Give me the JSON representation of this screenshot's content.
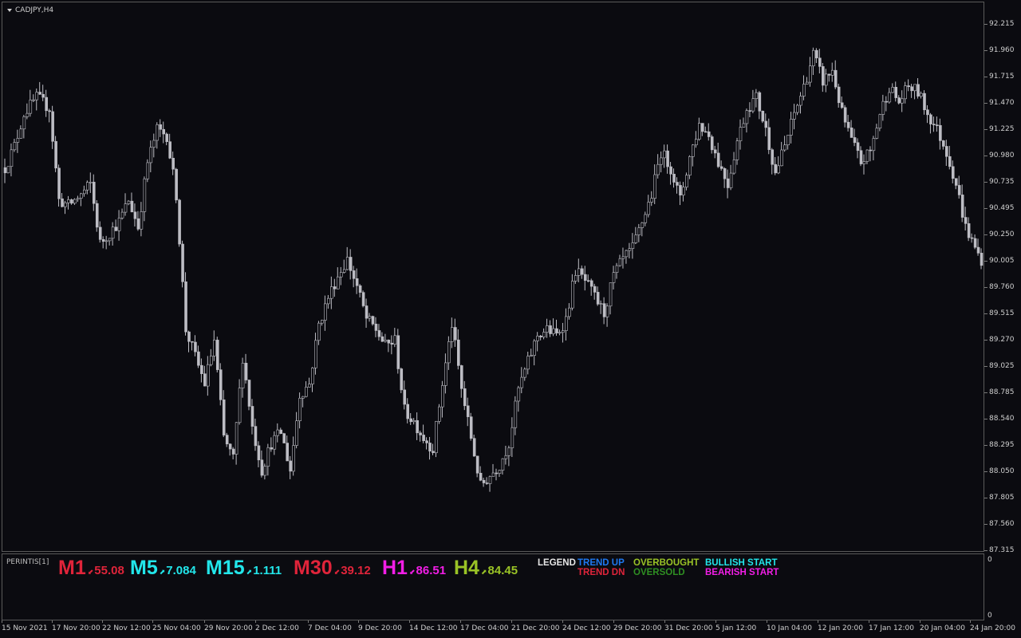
{
  "chart": {
    "symbol": "CADJPY,H4",
    "colors": {
      "background": "#0b0b10",
      "candle": "#bdbdc4",
      "frame": "#5a5a5a",
      "text": "#cfcfcf"
    },
    "price_labels": [
      "92.215",
      "91.960",
      "91.715",
      "91.470",
      "91.225",
      "90.980",
      "90.735",
      "90.495",
      "90.250",
      "90.005",
      "89.760",
      "89.515",
      "89.270",
      "89.025",
      "88.785",
      "88.540",
      "88.295",
      "88.050",
      "87.805",
      "87.560",
      "87.315"
    ],
    "time_labels": [
      "15 Nov 2021",
      "17 Nov 20:00",
      "22 Nov 12:00",
      "25 Nov 04:00",
      "29 Nov 20:00",
      "2 Dec 12:00",
      "7 Dec 04:00",
      "9 Dec 20:00",
      "14 Dec 12:00",
      "17 Dec 04:00",
      "21 Dec 20:00",
      "24 Dec 12:00",
      "29 Dec 20:00",
      "31 Dec 20:00",
      "5 Jan 12:00",
      "10 Jan 04:00",
      "12 Jan 20:00",
      "17 Jan 12:00",
      "20 Jan 04:00",
      "24 Jan 20:00"
    ]
  },
  "chart_data": {
    "type": "candlestick",
    "title": "CADJPY,H4",
    "ylim": [
      87.25,
      92.33
    ],
    "close_path": [
      [
        0,
        90.8
      ],
      [
        3,
        91.0
      ],
      [
        6,
        91.3
      ],
      [
        10,
        91.45
      ],
      [
        14,
        91.35
      ],
      [
        17,
        90.5
      ],
      [
        20,
        90.45
      ],
      [
        24,
        90.55
      ],
      [
        27,
        90.65
      ],
      [
        30,
        90.1
      ],
      [
        33,
        90.2
      ],
      [
        36,
        90.3
      ],
      [
        39,
        90.5
      ],
      [
        42,
        90.25
      ],
      [
        45,
        90.85
      ],
      [
        48,
        91.15
      ],
      [
        51,
        91.1
      ],
      [
        54,
        90.55
      ],
      [
        57,
        89.3
      ],
      [
        60,
        89.05
      ],
      [
        63,
        88.8
      ],
      [
        66,
        89.2
      ],
      [
        69,
        88.3
      ],
      [
        72,
        88.1
      ],
      [
        75,
        89.05
      ],
      [
        78,
        88.4
      ],
      [
        81,
        88.0
      ],
      [
        84,
        88.25
      ],
      [
        87,
        88.35
      ],
      [
        90,
        88.0
      ],
      [
        93,
        88.7
      ],
      [
        96,
        88.8
      ],
      [
        99,
        89.35
      ],
      [
        102,
        89.6
      ],
      [
        105,
        89.8
      ],
      [
        108,
        89.95
      ],
      [
        111,
        89.7
      ],
      [
        114,
        89.4
      ],
      [
        117,
        89.3
      ],
      [
        120,
        89.15
      ],
      [
        123,
        89.2
      ],
      [
        126,
        88.55
      ],
      [
        129,
        88.45
      ],
      [
        132,
        88.3
      ],
      [
        135,
        88.2
      ],
      [
        138,
        88.8
      ],
      [
        141,
        89.35
      ],
      [
        144,
        88.75
      ],
      [
        147,
        88.3
      ],
      [
        150,
        87.85
      ],
      [
        153,
        87.95
      ],
      [
        156,
        88.05
      ],
      [
        159,
        88.25
      ],
      [
        162,
        88.75
      ],
      [
        165,
        89.0
      ],
      [
        168,
        89.25
      ],
      [
        171,
        89.3
      ],
      [
        174,
        89.25
      ],
      [
        177,
        89.4
      ],
      [
        180,
        89.85
      ],
      [
        183,
        89.75
      ],
      [
        186,
        89.6
      ],
      [
        189,
        89.45
      ],
      [
        192,
        89.8
      ],
      [
        195,
        89.95
      ],
      [
        198,
        90.05
      ],
      [
        201,
        90.3
      ],
      [
        204,
        90.55
      ],
      [
        207,
        90.95
      ],
      [
        210,
        90.8
      ],
      [
        213,
        90.5
      ],
      [
        216,
        90.9
      ],
      [
        219,
        91.2
      ],
      [
        222,
        91.1
      ],
      [
        225,
        90.85
      ],
      [
        228,
        90.65
      ],
      [
        231,
        91.05
      ],
      [
        234,
        91.35
      ],
      [
        237,
        91.45
      ],
      [
        240,
        91.15
      ],
      [
        243,
        90.75
      ],
      [
        246,
        91.0
      ],
      [
        249,
        91.3
      ],
      [
        252,
        91.55
      ],
      [
        255,
        91.85
      ],
      [
        258,
        91.6
      ],
      [
        261,
        91.7
      ],
      [
        264,
        91.3
      ],
      [
        267,
        91.05
      ],
      [
        270,
        90.85
      ],
      [
        273,
        90.95
      ],
      [
        276,
        91.3
      ],
      [
        279,
        91.55
      ],
      [
        282,
        91.4
      ],
      [
        285,
        91.55
      ],
      [
        288,
        91.5
      ],
      [
        291,
        91.3
      ],
      [
        294,
        91.15
      ],
      [
        297,
        90.95
      ],
      [
        300,
        90.65
      ],
      [
        303,
        90.25
      ],
      [
        306,
        90.05
      ],
      [
        308,
        89.95
      ]
    ],
    "note": "Close prices traced along candle index 0-308; individual OHLC bars are generated around this path."
  },
  "indicator": {
    "name": "PERINTIS[1]",
    "axis_labels": [
      "0",
      "0"
    ],
    "timeframes": [
      {
        "label": "M1",
        "arrow": "down",
        "value": "55.08",
        "label_color": "#e0243a",
        "value_color": "#e0243a"
      },
      {
        "label": "M5",
        "arrow": "up",
        "value": "7.084",
        "label_color": "#22e6ea",
        "value_color": "#22e6ea"
      },
      {
        "label": "M15",
        "arrow": "up",
        "value": "1.111",
        "label_color": "#22e6ea",
        "value_color": "#22e6ea"
      },
      {
        "label": "M30",
        "arrow": "down",
        "value": "39.12",
        "label_color": "#e0243a",
        "value_color": "#e0243a"
      },
      {
        "label": "H1",
        "arrow": "down",
        "value": "86.51",
        "label_color": "#f21ee6",
        "value_color": "#f21ee6"
      },
      {
        "label": "H4",
        "arrow": "up",
        "value": "84.45",
        "label_color": "#9ac326",
        "value_color": "#9ac326"
      }
    ],
    "legend": {
      "title": "LEGEND",
      "trend_up": "TREND UP",
      "trend_dn": "TREND DN",
      "overbought": "OVERBOUGHT",
      "oversold": "OVERSOLD",
      "bullish_start": "BULLISH START",
      "bearish_start": "BEARISH START",
      "colors": {
        "title": "#e6e6e6",
        "trend_up": "#1e78f0",
        "trend_dn": "#e0243a",
        "overbought": "#9ac326",
        "oversold": "#2f8f22",
        "bullish_start": "#22e6ea",
        "bearish_start": "#f21ee6"
      }
    }
  }
}
